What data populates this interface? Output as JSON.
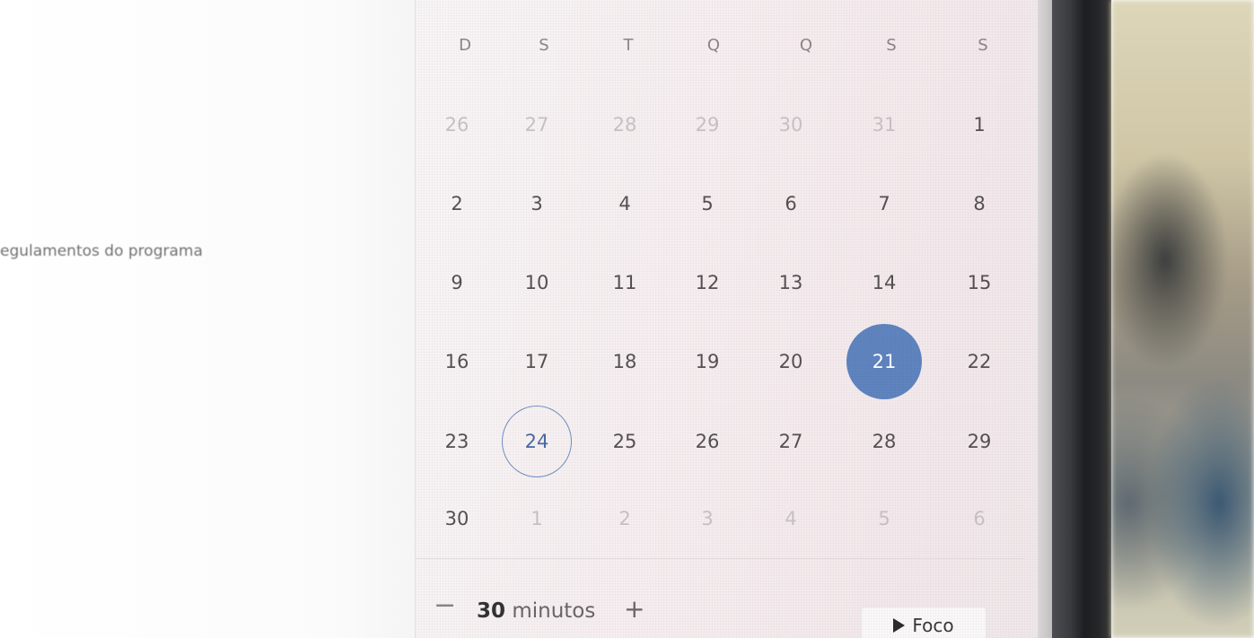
{
  "document": {
    "text": "egulamentos do programa"
  },
  "calendar": {
    "weekdays": [
      "D",
      "S",
      "T",
      "Q",
      "Q",
      "S",
      "S"
    ],
    "weeks": [
      [
        {
          "label": "26",
          "outside": true
        },
        {
          "label": "27",
          "outside": true
        },
        {
          "label": "28",
          "outside": true
        },
        {
          "label": "29",
          "outside": true
        },
        {
          "label": "30",
          "outside": true
        },
        {
          "label": "31",
          "outside": true
        },
        {
          "label": "1",
          "outside": false
        }
      ],
      [
        {
          "label": "2",
          "outside": false
        },
        {
          "label": "3",
          "outside": false
        },
        {
          "label": "4",
          "outside": false
        },
        {
          "label": "5",
          "outside": false
        },
        {
          "label": "6",
          "outside": false
        },
        {
          "label": "7",
          "outside": false
        },
        {
          "label": "8",
          "outside": false
        }
      ],
      [
        {
          "label": "9",
          "outside": false
        },
        {
          "label": "10",
          "outside": false
        },
        {
          "label": "11",
          "outside": false
        },
        {
          "label": "12",
          "outside": false
        },
        {
          "label": "13",
          "outside": false
        },
        {
          "label": "14",
          "outside": false
        },
        {
          "label": "15",
          "outside": false
        }
      ],
      [
        {
          "label": "16",
          "outside": false
        },
        {
          "label": "17",
          "outside": false
        },
        {
          "label": "18",
          "outside": false
        },
        {
          "label": "19",
          "outside": false
        },
        {
          "label": "20",
          "outside": false
        },
        {
          "label": "21",
          "outside": false,
          "selected": true
        },
        {
          "label": "22",
          "outside": false
        }
      ],
      [
        {
          "label": "23",
          "outside": false
        },
        {
          "label": "24",
          "outside": false,
          "today": true
        },
        {
          "label": "25",
          "outside": false
        },
        {
          "label": "26",
          "outside": false
        },
        {
          "label": "27",
          "outside": false
        },
        {
          "label": "28",
          "outside": false
        },
        {
          "label": "29",
          "outside": false
        }
      ],
      [
        {
          "label": "30",
          "outside": false
        },
        {
          "label": "1",
          "outside": true
        },
        {
          "label": "2",
          "outside": true
        },
        {
          "label": "3",
          "outside": true
        },
        {
          "label": "4",
          "outside": true
        },
        {
          "label": "5",
          "outside": true
        },
        {
          "label": "6",
          "outside": true
        }
      ]
    ],
    "selected_color": "#5f84bf",
    "today_ring_color": "#6f8fc2"
  },
  "focus_timer": {
    "minus_label": "−",
    "value": "30",
    "unit": "minutos",
    "plus_label": "+",
    "focus_icon": "play-icon",
    "focus_label": "Foco"
  }
}
